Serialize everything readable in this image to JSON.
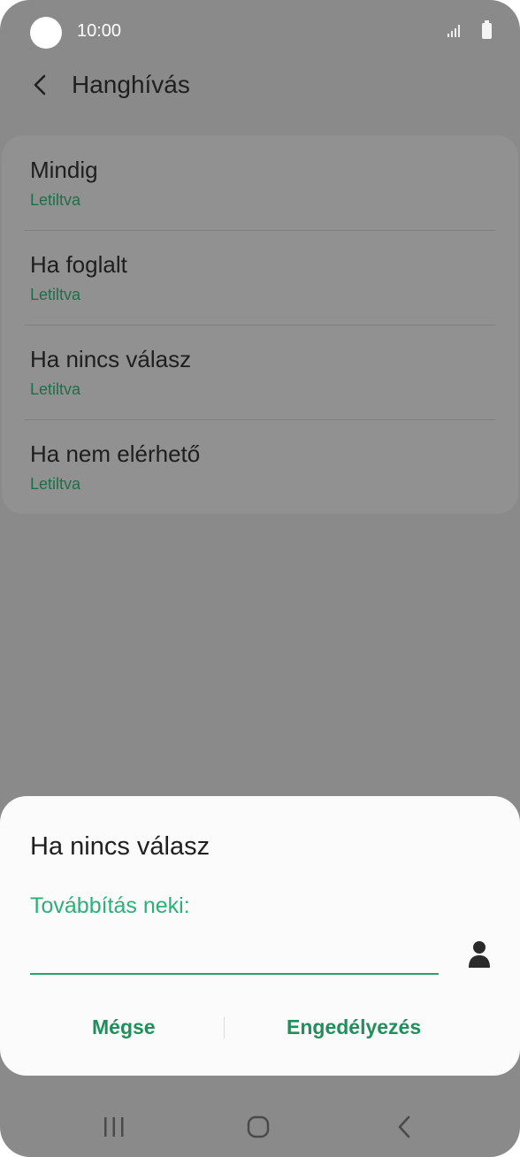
{
  "status_bar": {
    "time": "10:00"
  },
  "header": {
    "title": "Hanghívás"
  },
  "list": {
    "items": [
      {
        "title": "Mindig",
        "status": "Letiltva"
      },
      {
        "title": "Ha foglalt",
        "status": "Letiltva"
      },
      {
        "title": "Ha nincs válasz",
        "status": "Letiltva"
      },
      {
        "title": "Ha nem elérhető",
        "status": "Letiltva"
      }
    ]
  },
  "dialog": {
    "title": "Ha nincs válasz",
    "field_label": "Továbbítás neki:",
    "input_value": "",
    "cancel_label": "Mégse",
    "enable_label": "Engedélyezés"
  },
  "colors": {
    "accent": "#22a36c",
    "status_text": "#1d6f4a",
    "scrim": "#8a8a8a"
  },
  "icons": [
    "back-arrow-icon",
    "contact-person-icon",
    "signal-icon",
    "battery-icon",
    "recent-apps-icon",
    "home-icon",
    "nav-back-icon"
  ]
}
